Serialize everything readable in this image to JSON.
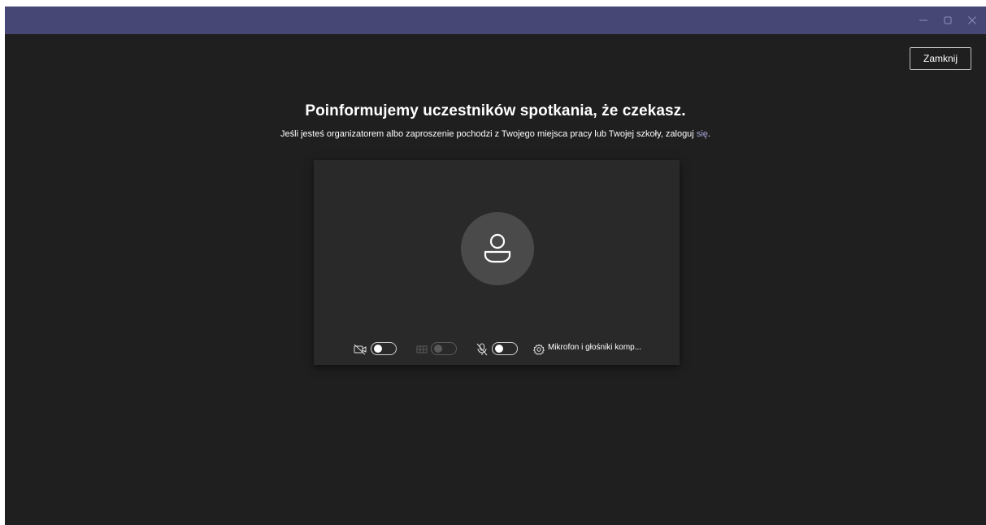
{
  "window": {
    "controls": {
      "minimize_icon": "minimize-icon",
      "maximize_icon": "maximize-icon",
      "close_icon": "close-icon"
    }
  },
  "close_button": {
    "label": "Zamknij"
  },
  "heading": "Poinformujemy uczestników spotkania, że czekasz.",
  "subheading": {
    "text": "Jeśli jesteś organizatorem albo zaproszenie pochodzi z Twojego miejsca pracy lub Twojej szkoły, zaloguj ",
    "link": "się",
    "suffix": "."
  },
  "preview": {
    "avatar_icon": "person-icon",
    "controls": {
      "camera": {
        "icon": "camera-off-icon",
        "state": "off"
      },
      "background": {
        "icon": "background-effects-icon",
        "state": "disabled"
      },
      "microphone": {
        "icon": "mic-off-icon",
        "state": "off"
      },
      "device_settings_icon": "gear-icon",
      "device_label": "Mikrofon i głośniki komp..."
    }
  },
  "colors": {
    "titlebar": "#464775",
    "background": "#201f1f",
    "preview": "#292929",
    "avatar": "#4a4a4a",
    "link": "#a6a7dc"
  }
}
